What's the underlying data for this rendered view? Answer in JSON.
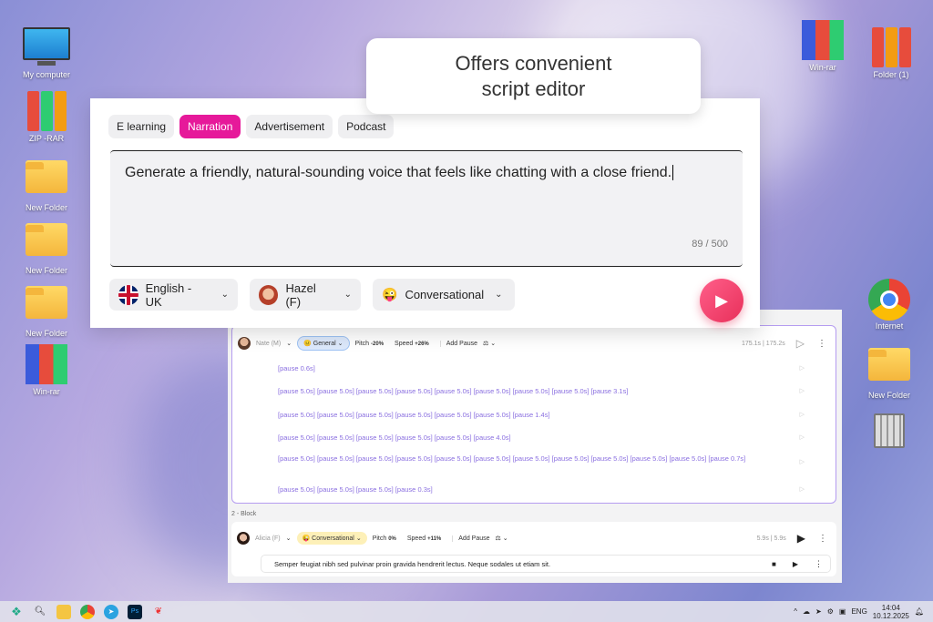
{
  "desktop": {
    "left_icons": [
      "My computer",
      "ZIP -RAR",
      "New Folder",
      "New Folder",
      "New Folder",
      "Win-rar"
    ],
    "right_icons": [
      "Win-rar",
      "Folder (1)",
      "Internet",
      "New Folder"
    ]
  },
  "callout": {
    "line1": "Offers convenient",
    "line2": "script editor"
  },
  "editor": {
    "tabs": [
      "E learning",
      "Narration",
      "Advertisement",
      "Podcast"
    ],
    "active_tab": "Narration",
    "text": "Generate a friendly, natural-sounding voice that feels like chatting with a close friend.",
    "count": "89 / 500",
    "language": "English - UK",
    "voice": "Hazel (F)",
    "style": "Conversational"
  },
  "block1": {
    "voice": "Nate (M)",
    "style": "General",
    "pitch_label": "Pitch",
    "pitch": "-20%",
    "speed_label": "Speed",
    "speed": "+26%",
    "add_pause": "Add Pause",
    "duration": "175.1s | 175.2s",
    "lines": [
      "[pause 0.6s]",
      "[pause 5.0s] [pause 5.0s] [pause 5.0s] [pause 5.0s] [pause 5.0s] [pause 5.0s] [pause 5.0s] [pause 5.0s] [pause 3.1s]",
      "[pause 5.0s] [pause 5.0s] [pause 5.0s] [pause 5.0s] [pause 5.0s] [pause 5.0s] [pause 1.4s]",
      "[pause 5.0s] [pause 5.0s] [pause 5.0s] [pause 5.0s] [pause 5.0s] [pause 4.0s]",
      "[pause 5.0s] [pause 5.0s] [pause 5.0s] [pause 5.0s] [pause 5.0s] [pause 5.0s] [pause 5.0s] [pause 5.0s] [pause 5.0s] [pause 5.0s] [pause 5.0s] [pause 0.7s]",
      "[pause 5.0s] [pause 5.0s] [pause 5.0s] [pause 0.3s]"
    ]
  },
  "block2": {
    "label": "2 -  Block",
    "voice": "Alicia (F)",
    "style": "Conversational",
    "pitch_label": "Pitch",
    "pitch": "0%",
    "speed_label": "Speed",
    "speed": "+11%",
    "add_pause": "Add Pause",
    "duration": "5.9s | 5.9s",
    "text": "Semper feugiat nibh sed pulvinar proin gravida hendrerit lectus. Neque sodales ut etiam sit."
  },
  "taskbar": {
    "lang": "ENG",
    "time": "14:04",
    "date": "10.12.2025"
  }
}
